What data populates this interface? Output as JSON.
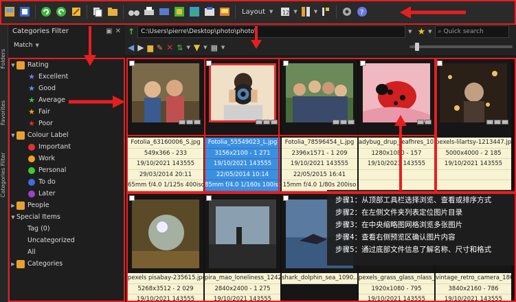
{
  "toolbar": {
    "layout_label": "Layout"
  },
  "search": {
    "placeholder": "Quick search"
  },
  "address": {
    "path": "C:\\Users\\pierre\\Desktop\\photo\\photo\\"
  },
  "left_tabs": [
    "Folders",
    "Favorites",
    "Categories Filter"
  ],
  "filter_panel": {
    "title": "Categories Filter",
    "match_label": "Match"
  },
  "tree": [
    {
      "label": "Rating",
      "level": 0,
      "expand": "▼",
      "icon": "rating-icon"
    },
    {
      "label": "Excellent",
      "level": 1,
      "icon": "star-icon",
      "color": "#7a7aff"
    },
    {
      "label": "Good",
      "level": 1,
      "icon": "star-icon",
      "color": "#4a9cff"
    },
    {
      "label": "Average",
      "level": 1,
      "icon": "star-icon",
      "color": "#3cc83c"
    },
    {
      "label": "Fair",
      "level": 1,
      "icon": "star-icon",
      "color": "#f0a020"
    },
    {
      "label": "Poor",
      "level": 1,
      "icon": "star-icon",
      "color": "#e03030"
    },
    {
      "label": "Colour Label",
      "level": 0,
      "expand": "▼",
      "icon": "colour-label-icon"
    },
    {
      "label": "Important",
      "level": 1,
      "icon": "dot-icon",
      "color": "#e53030"
    },
    {
      "label": "Work",
      "level": 1,
      "icon": "dot-icon",
      "color": "#f0a020"
    },
    {
      "label": "Personal",
      "level": 1,
      "icon": "dot-icon",
      "color": "#3cc83c"
    },
    {
      "label": "To do",
      "level": 1,
      "icon": "dot-icon",
      "color": "#3a70e0"
    },
    {
      "label": "Later",
      "level": 1,
      "icon": "dot-icon",
      "color": "#a040d0"
    },
    {
      "label": "People",
      "level": 0,
      "expand": "▶",
      "icon": "people-icon"
    },
    {
      "label": "Special Items",
      "level": 0,
      "expand": "▼",
      "icon": ""
    },
    {
      "label": "Tag (0)",
      "level": 1,
      "icon": ""
    },
    {
      "label": "Uncategorized",
      "level": 1,
      "icon": ""
    },
    {
      "label": "All",
      "level": 1,
      "icon": ""
    },
    {
      "label": "Categories",
      "level": 0,
      "expand": "▶",
      "icon": "categories-icon"
    }
  ],
  "thumbnails": [
    {
      "name": "Fotolia_63160006_S.jpg",
      "dims": "549x366 - 233",
      "date1": "19/10/2021 143555",
      "date2": "29/03/2014 20:11",
      "exif": "65mm f/4.0 1/125s 400iso",
      "selected": false
    },
    {
      "name": "Fotolia_55549023_L.jpg",
      "dims": "3156x2100 - 1 271",
      "date1": "19/10/2021 143555",
      "date2": "22/05/2014 10:14",
      "exif": "85mm f/4.0 1/160s 100iso",
      "selected": true
    },
    {
      "name": "Fotolia_78596454_L.jpg",
      "dims": "2396x1571 - 1 209",
      "date1": "19/10/2021 143555",
      "date2": "22/05/2015 16:41",
      "exif": "15mm f/4.0 1/80s 200iso",
      "selected": false
    },
    {
      "name": "adybug_drup_leafhres_1052...",
      "dims": "1280x1080 - 157",
      "date1": "19/10/2021 143555",
      "date2": "",
      "exif": "",
      "selected": false
    },
    {
      "name": "pexels-lilartsy-1213447.jpg",
      "dims": "5000x4000 - 2 185",
      "date1": "19/10/2021 143555",
      "date2": "",
      "exif": "",
      "selected": false
    },
    {
      "name": "pexels pisabay-235615.jpg",
      "dims": "5268x3512 - 2 029",
      "date1": "19/10/2021 143555",
      "selected": false
    },
    {
      "name": "pira_mao_loneliness_12427...",
      "dims": "2840x2400 - 1 275",
      "date1": "19/10/2021 143555",
      "selected": false
    },
    {
      "name": "shark_dolphin_sea_1090...",
      "dims": "",
      "date1": "",
      "selected": false
    },
    {
      "name": "pexels_grass_glass_nlass_155...",
      "dims": "1920x1080 - 795",
      "date1": "19/10/2021 143555",
      "selected": false
    },
    {
      "name": "vintage_retro_camera_1865...",
      "dims": "3840x2160 - 786",
      "date1": "19/10/2021 143555",
      "selected": false
    }
  ],
  "steps": [
    "步骤1：从顶部工具栏选择浏览、查看或排序方式",
    "步骤2：在左侧文件夹列表定位图片目录",
    "步骤3：在中央缩略图网格浏览多张图片",
    "步骤4：查看右侧预览区确认图片内容",
    "步骤5：通过底部文件信息了解名称、尺寸和格式"
  ],
  "colors": {
    "highlight": "#e81e1e",
    "selection": "#3b8fe0",
    "info_bg": "#f7f3d3"
  }
}
